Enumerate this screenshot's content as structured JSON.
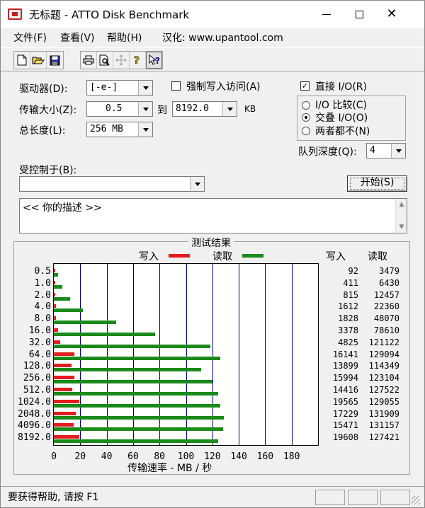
{
  "window": {
    "title": "无标题 - ATTO Disk Benchmark"
  },
  "menu": [
    "文件(F)",
    "查看(V)",
    "帮助(H)",
    "汉化: www.upantool.com"
  ],
  "toolbar_icons": [
    "new-icon",
    "open-icon",
    "save-icon",
    "print-icon",
    "print-preview-icon",
    "move-icon",
    "help-icon",
    "context-help-icon"
  ],
  "settings": {
    "drive_label": "驱动器(D):",
    "drive_value": "[-e-]",
    "force_write_label": "强制写入访问(A)",
    "direct_io_label": "直接 I/O(R)",
    "transfer_size_label": "传输大小(Z):",
    "transfer_from": "0.5",
    "to_label": "到",
    "transfer_to": "8192.0",
    "kb_label": "KB",
    "io_compare_label": "I/O 比较(C)",
    "overlap_io_label": "交叠 I/O(O)",
    "neither_label": "两者都不(N)",
    "total_length_label": "总长度(L):",
    "total_length_value": "256 MB",
    "queue_depth_label": "队列深度(Q):",
    "queue_depth_value": "4",
    "controlled_by_label": "受控制于(B):",
    "controlled_by_value": "",
    "start_button": "开始(S)",
    "description": "<<  你的描述  >>"
  },
  "results": {
    "title": "测试结果",
    "legend_write": "写入",
    "legend_read": "读取",
    "col_write": "写入",
    "col_read": "读取",
    "xlabel": "传输速率 - MB / 秒",
    "colors": {
      "write": "#e41c1c",
      "read": "#1a8a1a",
      "grid": "#000080"
    }
  },
  "chart_data": {
    "type": "bar",
    "orientation": "horizontal",
    "categories": [
      "0.5",
      "1.0",
      "2.0",
      "4.0",
      "8.0",
      "16.0",
      "32.0",
      "64.0",
      "128.0",
      "256.0",
      "512.0",
      "1024.0",
      "2048.0",
      "4096.0",
      "8192.0"
    ],
    "series": [
      {
        "name": "写入",
        "values": [
          92,
          411,
          815,
          1612,
          1828,
          3378,
          4825,
          16141,
          13899,
          15994,
          14416,
          19565,
          17229,
          15471,
          19608
        ]
      },
      {
        "name": "读取",
        "values": [
          3479,
          6430,
          12457,
          22360,
          48070,
          78610,
          121122,
          129094,
          114349,
          123104,
          127522,
          129055,
          131909,
          131157,
          127421
        ]
      }
    ],
    "xticks": [
      0,
      20,
      40,
      60,
      80,
      100,
      120,
      140,
      160,
      180
    ],
    "xlim": [
      0,
      200
    ],
    "grid": true
  },
  "status": {
    "text": "要获得帮助, 请按 F1"
  }
}
